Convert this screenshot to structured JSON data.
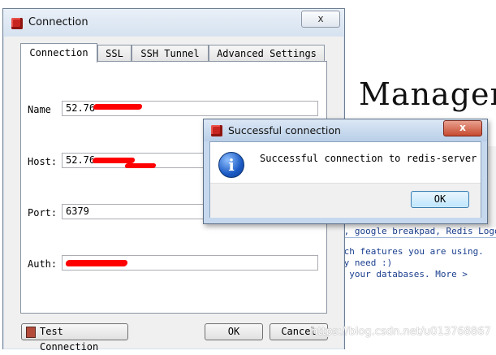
{
  "background": {
    "heading": "Manager",
    "line1": "e, google breakpad, Redis Logo a",
    "line2": "ich features you are using.",
    "line3": "ly need :)",
    "line4": "m your databases. More >"
  },
  "connection_window": {
    "title": "Connection",
    "close_label": "x",
    "tabs": [
      {
        "label": "Connection"
      },
      {
        "label": "SSL"
      },
      {
        "label": "SSH Tunnel"
      },
      {
        "label": "Advanced Settings"
      }
    ],
    "fields": {
      "name": {
        "label": "Name",
        "value": "52.76"
      },
      "host": {
        "label": "Host:",
        "value": "52.76"
      },
      "port": {
        "label": "Port:",
        "value": "6379"
      },
      "auth": {
        "label": "Auth:",
        "value": ""
      }
    },
    "buttons": {
      "test": "Test Connection",
      "ok": "OK",
      "cancel": "Cancel"
    }
  },
  "success_dialog": {
    "title": "Successful connection",
    "close_label": "x",
    "message": "Successful connection to redis-server",
    "ok_label": "OK",
    "icon": "info-icon"
  },
  "watermark": "https://blog.csdn.net/u013768867",
  "colors": {
    "redaction": "#ff0000",
    "app_icon": "#c7251f",
    "info_icon": "#1c5bc4",
    "dialog_frame": "#c5d8ee"
  }
}
